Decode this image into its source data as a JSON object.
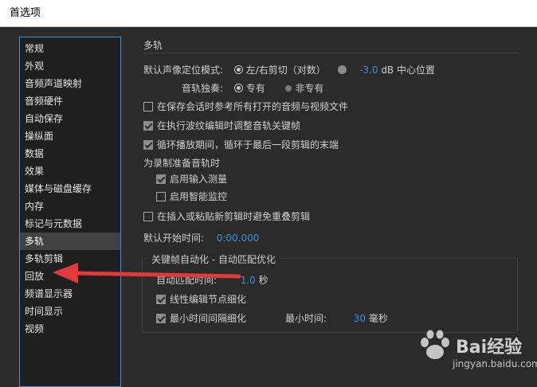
{
  "window": {
    "title": "首选项"
  },
  "sidebar": {
    "items": [
      {
        "label": "常规"
      },
      {
        "label": "外观"
      },
      {
        "label": "音频声道映射"
      },
      {
        "label": "音频硬件"
      },
      {
        "label": "自动保存"
      },
      {
        "label": "操纵面"
      },
      {
        "label": "数据"
      },
      {
        "label": "效果"
      },
      {
        "label": "媒体与磁盘缓存"
      },
      {
        "label": "内存"
      },
      {
        "label": "标记与元数据"
      },
      {
        "label": "多轨"
      },
      {
        "label": "多轨剪辑"
      },
      {
        "label": "回放"
      },
      {
        "label": "频谱显示器"
      },
      {
        "label": "时间显示"
      },
      {
        "label": "视频"
      }
    ],
    "selected": "多轨"
  },
  "panel": {
    "section_title": "多轨",
    "pan_mode": {
      "label": "默认声像定位模式:",
      "option1": "左/右剪切（对数）",
      "value": "-3.0",
      "unit": "dB 中心位置"
    },
    "solo": {
      "label": "音轨独奏:",
      "option1": "专有",
      "option2": "非专有"
    },
    "checks": {
      "c1": "在保存会话时参考所有打开的音频与视频文件",
      "c2": "在执行波纹编辑时调整音轨关键帧",
      "c3": "循环播放期间，循环于最后一段剪辑的末端"
    },
    "record_prep": {
      "title": "为录制准备音轨时",
      "c1": "启用输入测量",
      "c2": "启用智能监控"
    },
    "c4": "在插入或粘贴新剪辑时避免重叠剪辑",
    "default_start": {
      "label": "默认开始时间:",
      "value": "0:00.000"
    },
    "keyframe_group": {
      "title": "关键帧自动化 - 自动匹配优化",
      "match_time_label": "自动匹配时间:",
      "match_time_value": "1.0",
      "match_time_unit": "秒",
      "c1": "线性编辑节点细化",
      "c2": "最小时间间隔细化",
      "min_time_label": "最小时间:",
      "min_time_value": "30",
      "min_time_unit": "毫秒"
    }
  },
  "watermark": {
    "brand": "Bai经验",
    "url": "jingyan.baidu.com"
  },
  "colors": {
    "accent": "#3d8fd6",
    "arrow": "#e03a3a"
  }
}
